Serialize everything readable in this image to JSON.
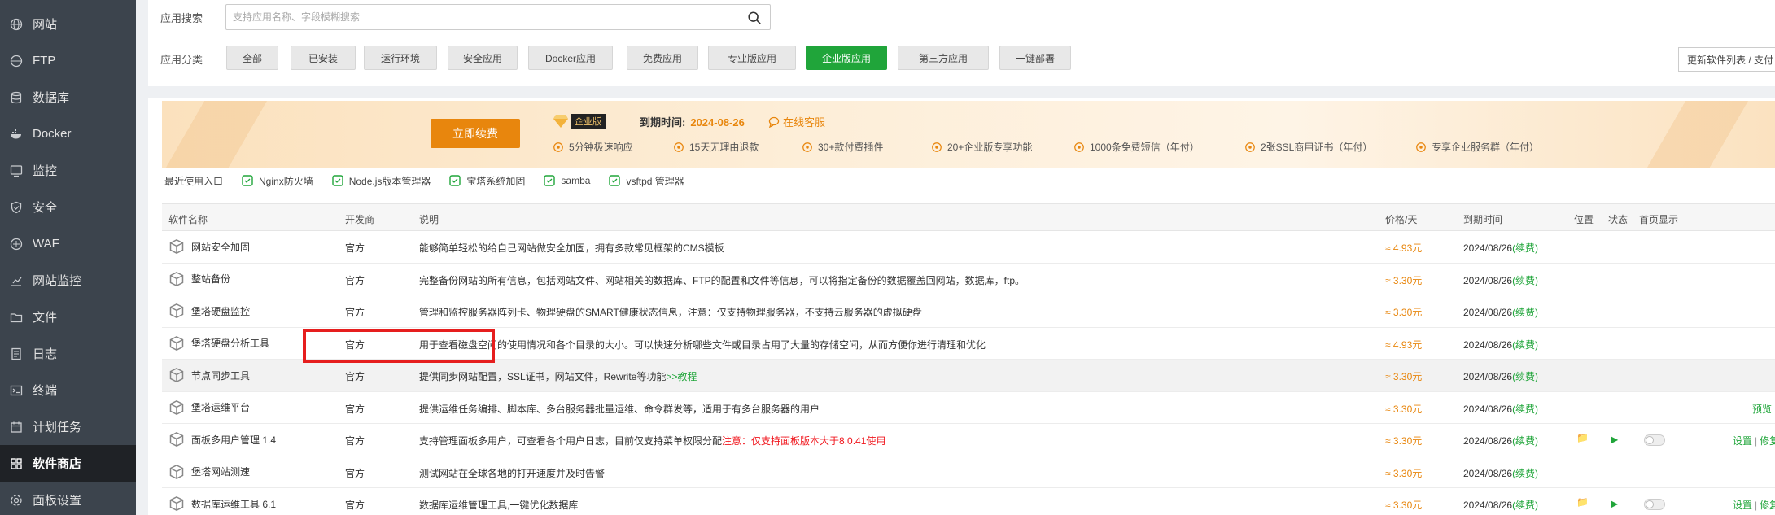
{
  "sidebar": {
    "items": [
      {
        "label": "网站",
        "icon": "globe-icon"
      },
      {
        "label": "FTP",
        "icon": "ftp-icon"
      },
      {
        "label": "数据库",
        "icon": "database-icon"
      },
      {
        "label": "Docker",
        "icon": "docker-icon"
      },
      {
        "label": "监控",
        "icon": "monitor-icon"
      },
      {
        "label": "安全",
        "icon": "shield-icon"
      },
      {
        "label": "WAF",
        "icon": "waf-icon"
      },
      {
        "label": "网站监控",
        "icon": "chart-icon"
      },
      {
        "label": "文件",
        "icon": "folder-icon"
      },
      {
        "label": "日志",
        "icon": "log-icon"
      },
      {
        "label": "终端",
        "icon": "terminal-icon"
      },
      {
        "label": "计划任务",
        "icon": "calendar-icon"
      },
      {
        "label": "软件商店",
        "icon": "grid-icon",
        "active": true
      },
      {
        "label": "面板设置",
        "icon": "gear-icon"
      }
    ]
  },
  "search": {
    "label": "应用搜索",
    "placeholder": "支持应用名称、字段模糊搜索",
    "value": ""
  },
  "categories": {
    "label": "应用分类",
    "items": [
      "全部",
      "已安装",
      "运行环境",
      "安全应用",
      "Docker应用",
      "免费应用",
      "专业版应用",
      "企业版应用",
      "第三方应用",
      "一键部署"
    ],
    "active": "企业版应用"
  },
  "update_button": "更新软件列表 / 支付",
  "banner": {
    "renew_button": "立即续费",
    "edition": "企业版",
    "expire_label": "到期时间:",
    "expire_date": "2024-08-26",
    "online_service": "在线客服",
    "perks": [
      "5分钟极速响应",
      "15天无理由退款",
      "30+款付费插件",
      "20+企业版专享功能",
      "1000条免费短信（年付）",
      "2张SSL商用证书（年付）",
      "专享企业服务群（年付）"
    ]
  },
  "recent": {
    "label": "最近使用入口",
    "items": [
      "Nginx防火墙",
      "Node.js版本管理器",
      "宝塔系统加固",
      "samba",
      "vsftpd 管理器"
    ]
  },
  "table": {
    "headers": [
      "软件名称",
      "开发商",
      "说明",
      "价格/天",
      "到期时间",
      "位置",
      "状态",
      "首页显示"
    ],
    "rows": [
      {
        "name": "网站安全加固",
        "dev": "官方",
        "desc": "能够简单轻松的给自己网站做安全加固，拥有多款常见框架的CMS模板",
        "price": "≈ 4.93元",
        "expire": "2024/08/26",
        "renew": "(续费)"
      },
      {
        "name": "整站备份",
        "dev": "官方",
        "desc": "完整备份网站的所有信息，包括网站文件、网站相关的数据库、FTP的配置和文件等信息，可以将指定备份的数据覆盖回网站，数据库，ftp。",
        "price": "≈ 3.30元",
        "expire": "2024/08/26",
        "renew": "(续费)"
      },
      {
        "name": "堡塔硬盘监控",
        "dev": "官方",
        "desc": "管理和监控服务器阵列卡、物理硬盘的SMART健康状态信息，注意：仅支持物理服务器，不支持云服务器的虚拟硬盘",
        "price": "≈ 3.30元",
        "expire": "2024/08/26",
        "renew": "(续费)"
      },
      {
        "name": "堡塔硬盘分析工具",
        "dev": "官方",
        "desc": "用于查看磁盘空间的使用情况和各个目录的大小。可以快速分析哪些文件或目录占用了大量的存储空间，从而方便你进行清理和优化",
        "price": "≈ 4.93元",
        "expire": "2024/08/26",
        "renew": "(续费)"
      },
      {
        "name": "节点同步工具",
        "dev": "官方",
        "desc": "提供同步网站配置，SSL证书，网站文件，Rewrite等功能",
        "desc_link": ">>教程",
        "price": "≈ 3.30元",
        "expire": "2024/08/26",
        "renew": "(续费)"
      },
      {
        "name": "堡塔运维平台",
        "dev": "官方",
        "desc": "提供运维任务编排、脚本库、多台服务器批量运维、命令群发等，适用于有多台服务器的用户",
        "price": "≈ 3.30元",
        "expire": "2024/08/26",
        "renew": "(续费)",
        "op1": "预览"
      },
      {
        "name": "面板多用户管理 1.4",
        "dev": "官方",
        "desc": "支持管理面板多用户，可查看各个用户日志，目前仅支持菜单权限分配",
        "desc_warn": "注意：仅支持面板版本大于8.0.41使用",
        "price": "≈ 3.30元",
        "expire": "2024/08/26",
        "renew": "(续费)",
        "op1": "设置",
        "op2": "修复",
        "installed": true
      },
      {
        "name": "堡塔网站测速",
        "dev": "官方",
        "desc": "测试网站在全球各地的打开速度并及时告警",
        "price": "≈ 3.30元",
        "expire": "2024/08/26",
        "renew": "(续费)"
      },
      {
        "name": "数据库运维工具 6.1",
        "dev": "官方",
        "desc": "数据库运维管理工具,一键优化数据库",
        "price": "≈ 3.30元",
        "expire": "2024/08/26",
        "renew": "(续费)",
        "op1": "设置",
        "op2": "修复",
        "installed": true
      }
    ]
  },
  "colors": {
    "accent": "#20a53a",
    "warning": "#e8860d",
    "highlight": "#e61e1e",
    "sidebar": "#3c444d"
  }
}
